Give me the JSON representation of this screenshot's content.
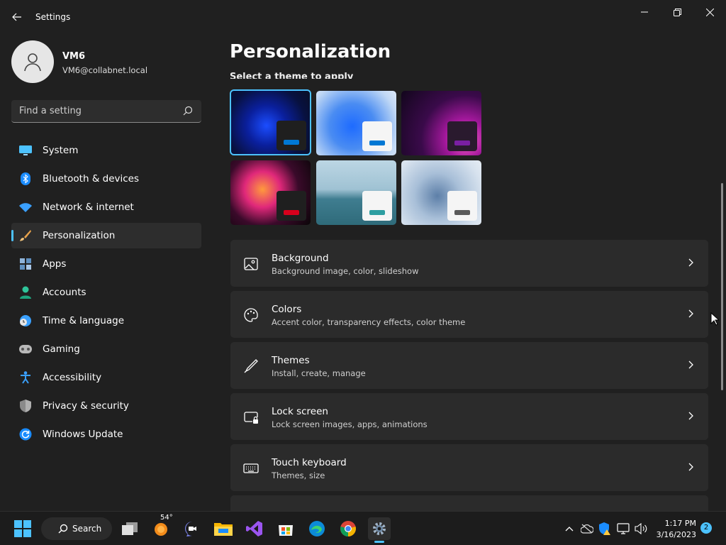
{
  "window": {
    "title": "Settings"
  },
  "user": {
    "name": "VM6",
    "email": "VM6@collabnet.local"
  },
  "search": {
    "placeholder": "Find a setting"
  },
  "nav": {
    "items": [
      {
        "label": "System",
        "icon": "monitor-icon"
      },
      {
        "label": "Bluetooth & devices",
        "icon": "bluetooth-icon"
      },
      {
        "label": "Network & internet",
        "icon": "wifi-icon"
      },
      {
        "label": "Personalization",
        "icon": "brush-icon",
        "active": true
      },
      {
        "label": "Apps",
        "icon": "apps-icon"
      },
      {
        "label": "Accounts",
        "icon": "person-icon"
      },
      {
        "label": "Time & language",
        "icon": "globe-clock-icon"
      },
      {
        "label": "Gaming",
        "icon": "gamepad-icon"
      },
      {
        "label": "Accessibility",
        "icon": "accessibility-icon"
      },
      {
        "label": "Privacy & security",
        "icon": "shield-icon"
      },
      {
        "label": "Windows Update",
        "icon": "update-icon"
      }
    ]
  },
  "main": {
    "title": "Personalization",
    "themes_label": "Select a theme to apply",
    "cards": [
      {
        "title": "Background",
        "desc": "Background image, color, slideshow",
        "icon": "image-icon"
      },
      {
        "title": "Colors",
        "desc": "Accent color, transparency effects, color theme",
        "icon": "palette-icon"
      },
      {
        "title": "Themes",
        "desc": "Install, create, manage",
        "icon": "pen-icon"
      },
      {
        "title": "Lock screen",
        "desc": "Lock screen images, apps, animations",
        "icon": "lock-screen-icon"
      },
      {
        "title": "Touch keyboard",
        "desc": "Themes, size",
        "icon": "keyboard-icon"
      }
    ]
  },
  "colors": {
    "accent": "#4cc2ff",
    "background": "#202020",
    "card": "#2b2b2b"
  },
  "taskbar": {
    "search_label": "Search",
    "weather_temp": "54°",
    "time": "1:17 PM",
    "date": "3/16/2023",
    "notifications": "2"
  }
}
